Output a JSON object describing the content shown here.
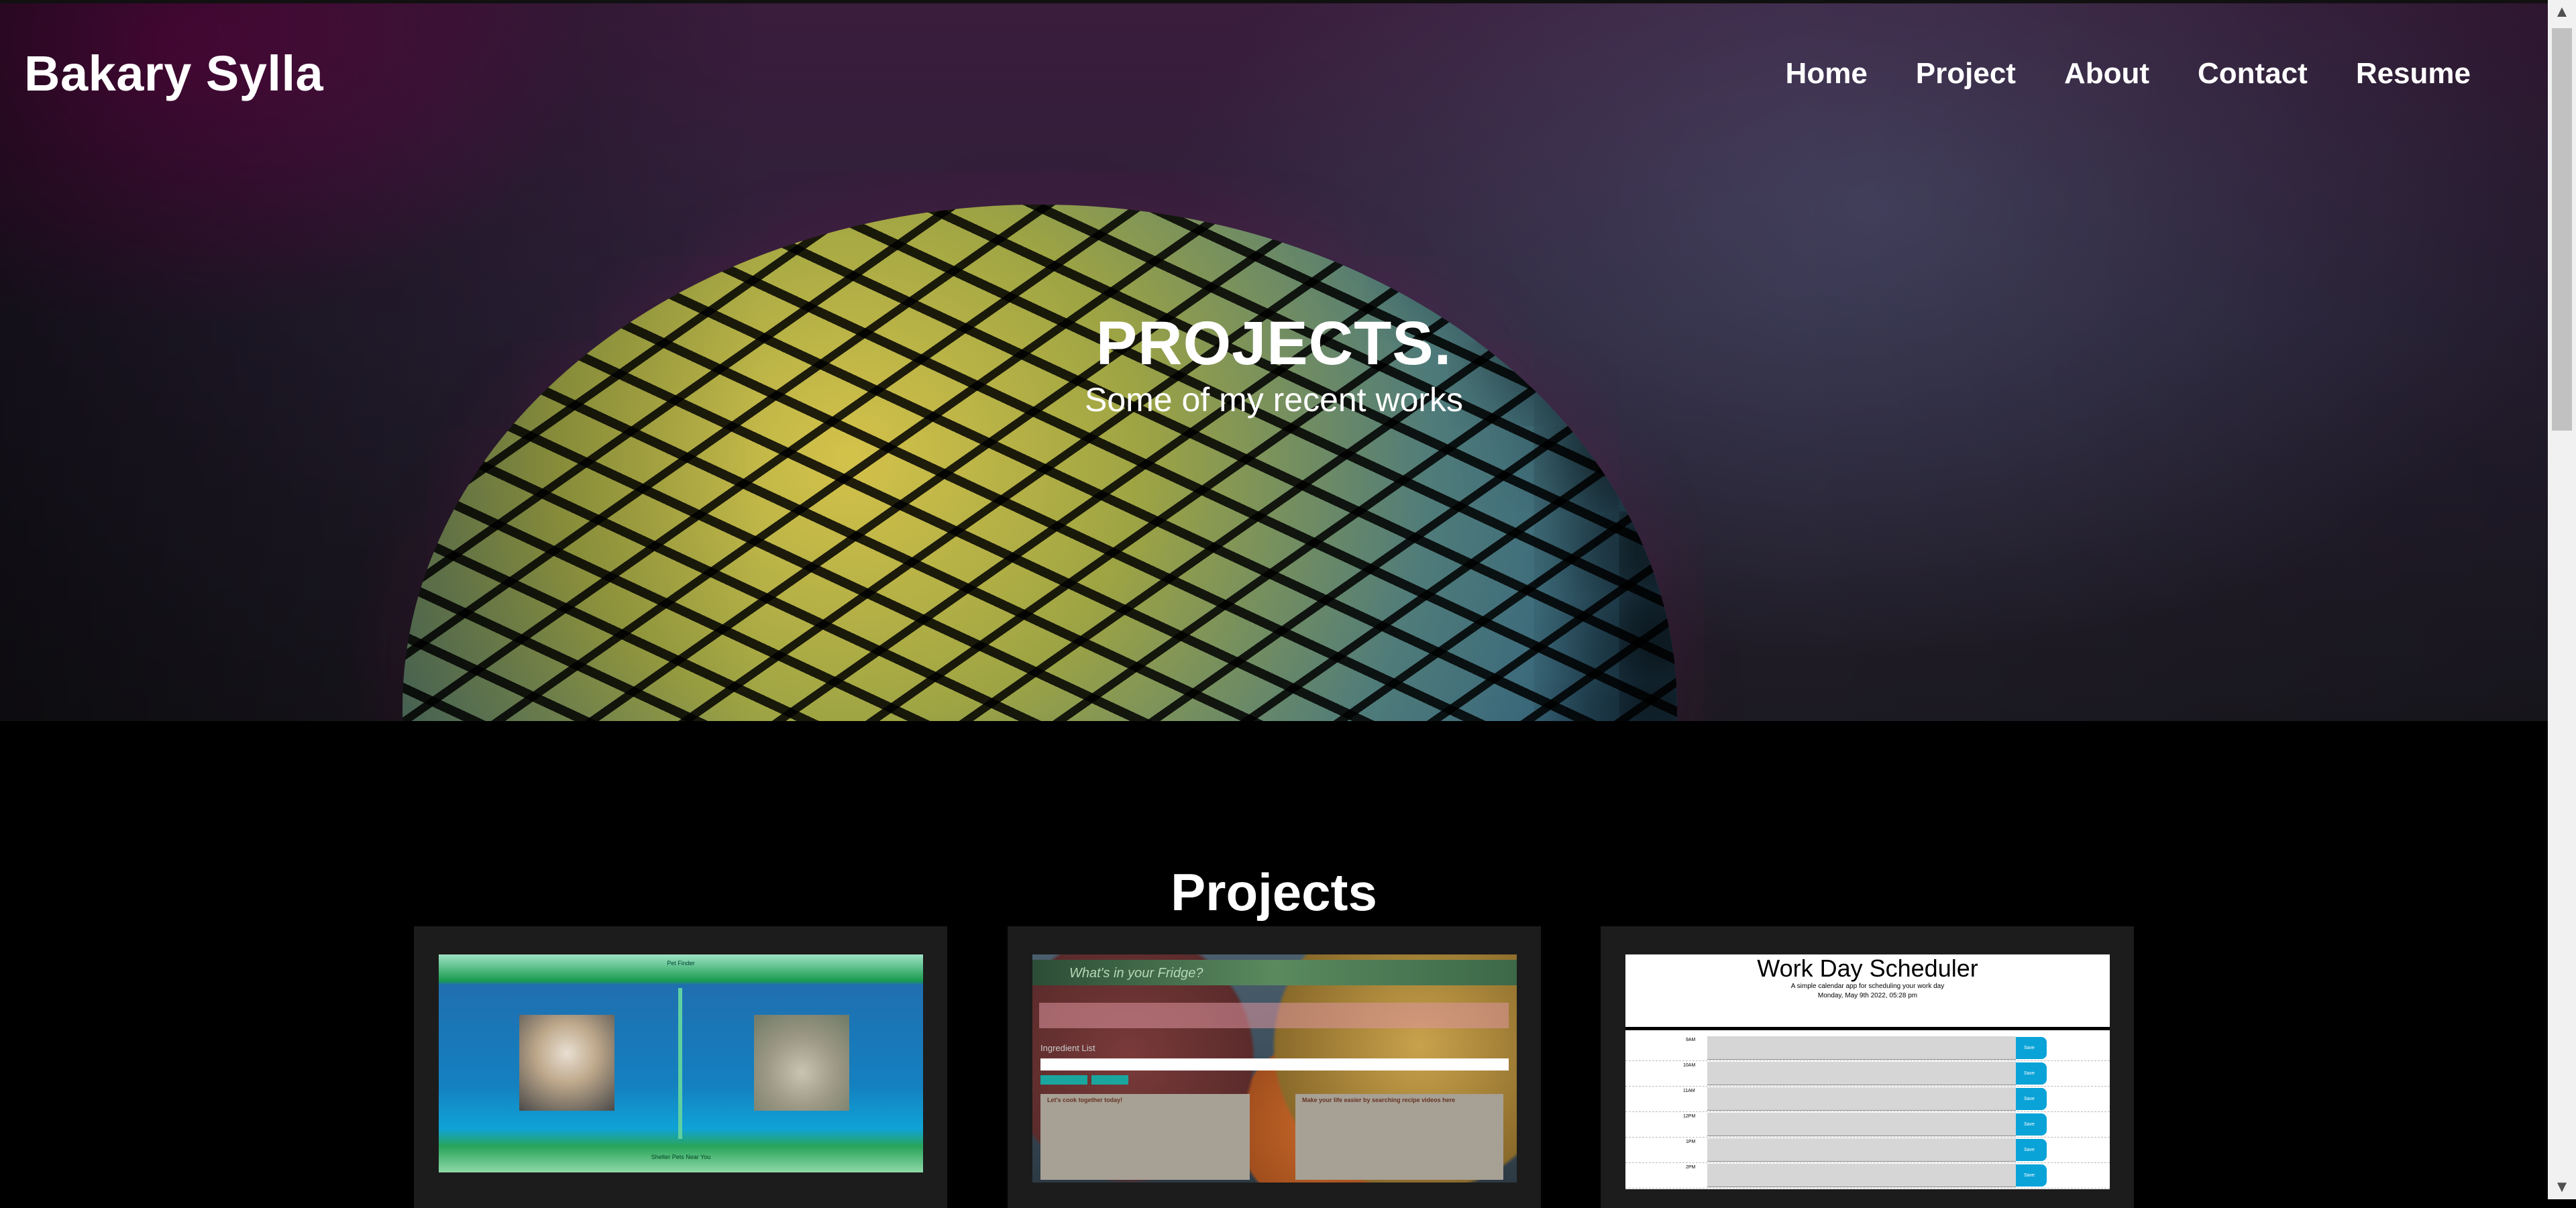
{
  "header": {
    "brand": "Bakary Sylla",
    "nav": [
      "Home",
      "Project",
      "About",
      "Contact",
      "Resume"
    ]
  },
  "hero": {
    "title": "PROJECTS.",
    "subtitle": "Some of my recent works"
  },
  "projects": {
    "heading": "Projects",
    "cards": [
      {
        "name": "Pet Finder",
        "heading_text": "Pet Finder",
        "footer_text": "Shelter Pets Near You"
      },
      {
        "name": "What's in your Fridge?",
        "search_placeholder": "What's in your Fridge?",
        "ingredient_label": "Ingredient List",
        "left_panel_title": "Let's cook together today!",
        "right_panel_title": "Make your life easier by searching recipe videos here"
      },
      {
        "name": "Work Day Scheduler",
        "title": "Work Day Scheduler",
        "subtitle": "A simple calendar app for scheduling your work day",
        "date": "Monday, May 9th 2022, 05:28 pm",
        "hours": [
          "9AM",
          "10AM",
          "11AM",
          "12PM",
          "1PM",
          "2PM"
        ],
        "save_label": "Save"
      }
    ]
  },
  "scrollbar": {
    "up_arrow": "▲",
    "down_arrow": "▼"
  }
}
